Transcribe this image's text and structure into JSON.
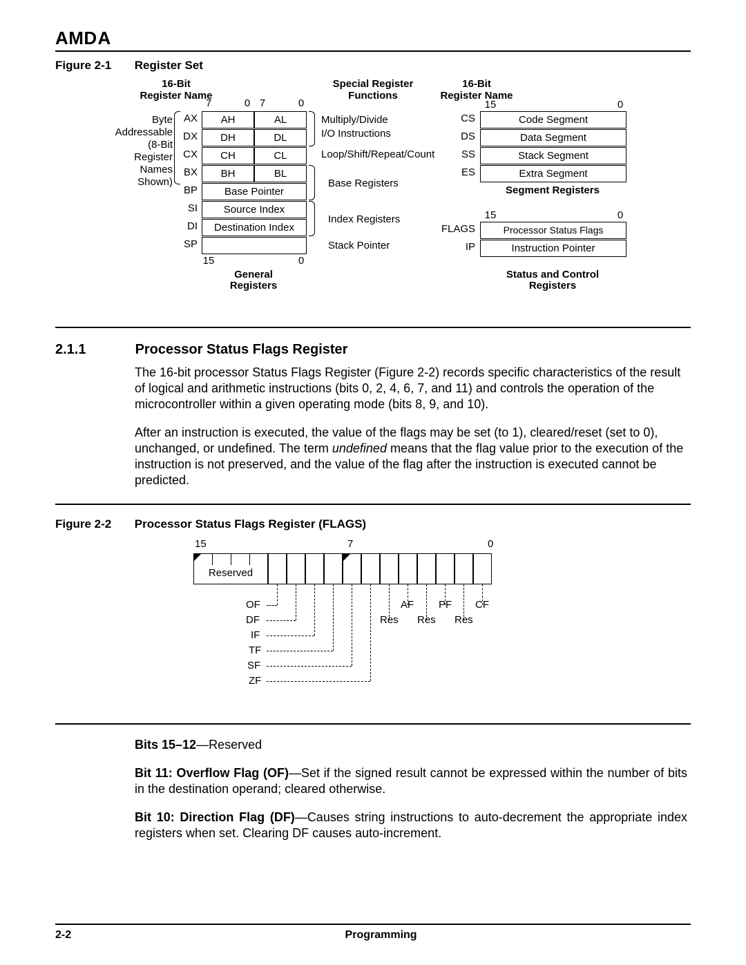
{
  "header": {
    "logo": "AMD"
  },
  "figure1": {
    "caption_num": "Figure 2-1",
    "caption_title": "Register Set",
    "left_title1": "16-Bit",
    "left_title2": "Register Name",
    "byte_addr_1": "Byte",
    "byte_addr_2": "Addressable",
    "byte_addr_3": "(8-Bit",
    "byte_addr_4": "Register",
    "byte_addr_5": "Names",
    "byte_addr_6": "Shown)",
    "reg_names": [
      "AX",
      "DX",
      "CX",
      "BX",
      "BP",
      "SI",
      "DI",
      "SP"
    ],
    "byte_pairs": [
      [
        "AH",
        "AL"
      ],
      [
        "DH",
        "DL"
      ],
      [
        "CH",
        "CL"
      ],
      [
        "BH",
        "BL"
      ]
    ],
    "word_regs": [
      "Base Pointer",
      "Source Index",
      "Destination Index"
    ],
    "gen_bits_l7": "7",
    "gen_bits_l0": "0",
    "gen_bits_r7": "7",
    "gen_bits_r0": "0",
    "gen_bottom_15": "15",
    "gen_bottom_0": "0",
    "gen_label1": "General",
    "gen_label2": "Registers",
    "spec_title1": "Special Register",
    "spec_title2": "Functions",
    "func_1": "Multiply/Divide",
    "func_2": "I/O Instructions",
    "func_3": "Loop/Shift/Repeat/Count",
    "func_4": "Base Registers",
    "func_5": "Index Registers",
    "func_6": "Stack Pointer",
    "seg_title1": "16-Bit",
    "seg_title2": "Register Name",
    "seg_bits_15": "15",
    "seg_bits_0": "0",
    "seg_names": [
      "CS",
      "DS",
      "SS",
      "ES"
    ],
    "seg_vals": [
      "Code Segment",
      "Data Segment",
      "Stack Segment",
      "Extra Segment"
    ],
    "seg_label": "Segment Registers",
    "sc_bits_15": "15",
    "sc_bits_0": "0",
    "sc_names": [
      "FLAGS",
      "IP"
    ],
    "sc_vals": [
      "Processor Status Flags",
      "Instruction Pointer"
    ],
    "sc_label1": "Status and Control",
    "sc_label2": "Registers"
  },
  "section": {
    "num": "2.1.1",
    "title": "Processor Status Flags Register",
    "p1": "The 16-bit processor Status Flags Register (Figure 2-2) records specific characteristics of the result of logical and arithmetic instructions (bits 0, 2, 4, 6, 7, and 11) and controls the operation of the microcontroller within a given operating mode (bits 8, 9, and 10).",
    "p2a": "After an instruction is executed, the value of the flags may be set (to 1), cleared/reset (set to 0), unchanged, or undefined. The term ",
    "p2b_ital": "undefined ",
    "p2c": "means that the flag value prior to the execution of the instruction is not preserved, and the value of the flag after the instruction is executed cannot be predicted."
  },
  "figure2": {
    "caption_num": "Figure 2-2",
    "caption_title": "Processor Status Flags Register (FLAGS)",
    "bit15": "15",
    "bit7": "7",
    "bit0": "0",
    "rsv": "Reserved",
    "flags_left": [
      "OF",
      "DF",
      "IF",
      "TF",
      "SF",
      "ZF"
    ],
    "flags_right_row1": [
      "AF",
      "PF",
      "CF"
    ],
    "flags_right_row2": [
      "Res",
      "Res",
      "Res"
    ]
  },
  "bitdesc": {
    "b15_bold": "Bits 15–12",
    "b15_txt": "—Reserved",
    "b11_bold": "Bit 11: Overflow Flag (OF)",
    "b11_txt": "—Set if the signed result cannot be expressed within the number of bits in the destination operand; cleared otherwise.",
    "b10_bold": "Bit 10: Direction Flag (DF)",
    "b10_txt": "—Causes string instructions to auto-decrement the appropriate index registers when set. Clearing DF causes auto-increment."
  },
  "footer": {
    "page": "2-2",
    "chapter": "Programming"
  }
}
